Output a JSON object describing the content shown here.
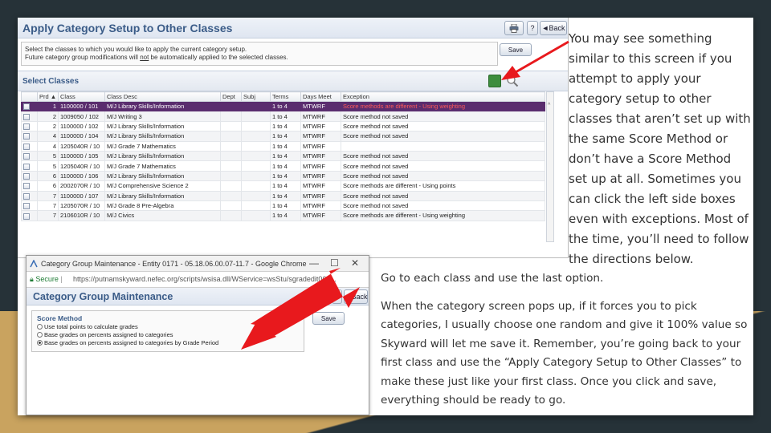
{
  "screenshot1": {
    "title": "Apply Category Setup to Other Classes",
    "print_label": "",
    "help_label": "?",
    "back_label": "◄Back",
    "instructions": {
      "line1": "Select the classes to which you would like to apply the current category setup.",
      "line2_prefix": "Future category group modifications will ",
      "line2_emph": "not",
      "line2_suffix": " be automatically applied to the selected classes."
    },
    "save_label": "Save",
    "section_label": "Select Classes",
    "columns": [
      "",
      "Prd ▲",
      "Class",
      "Class Desc",
      "Dept",
      "Subj",
      "Terms",
      "Days Meet",
      "Exception"
    ],
    "rows": [
      {
        "prd": "1",
        "class": "1100000 / 101",
        "desc": "M/J Library Skills/Information",
        "dept": "",
        "subj": "",
        "terms": "1 to 4",
        "days": "MTWRF",
        "exception": "Score methods are different - Using weighting",
        "selected": true
      },
      {
        "prd": "2",
        "class": "1009050 / 102",
        "desc": "M/J Writing 3",
        "dept": "",
        "subj": "",
        "terms": "1 to 4",
        "days": "MTWRF",
        "exception": "Score method not saved"
      },
      {
        "prd": "2",
        "class": "1100000 / 102",
        "desc": "M/J Library Skills/Information",
        "dept": "",
        "subj": "",
        "terms": "1 to 4",
        "days": "MTWRF",
        "exception": "Score method not saved"
      },
      {
        "prd": "4",
        "class": "1100000 / 104",
        "desc": "M/J Library Skills/Information",
        "dept": "",
        "subj": "",
        "terms": "1 to 4",
        "days": "MTWRF",
        "exception": "Score method not saved"
      },
      {
        "prd": "4",
        "class": "1205040R / 10",
        "desc": "M/J Grade 7 Mathematics",
        "dept": "",
        "subj": "",
        "terms": "1 to 4",
        "days": "MTWRF",
        "exception": ""
      },
      {
        "prd": "5",
        "class": "1100000 / 105",
        "desc": "M/J Library Skills/Information",
        "dept": "",
        "subj": "",
        "terms": "1 to 4",
        "days": "MTWRF",
        "exception": "Score method not saved"
      },
      {
        "prd": "5",
        "class": "1205040R / 10",
        "desc": "M/J Grade 7 Mathematics",
        "dept": "",
        "subj": "",
        "terms": "1 to 4",
        "days": "MTWRF",
        "exception": "Score method not saved"
      },
      {
        "prd": "6",
        "class": "1100000 / 106",
        "desc": "M/J Library Skills/Information",
        "dept": "",
        "subj": "",
        "terms": "1 to 4",
        "days": "MTWRF",
        "exception": "Score method not saved"
      },
      {
        "prd": "6",
        "class": "2002070R / 10",
        "desc": "M/J Comprehensive Science 2",
        "dept": "",
        "subj": "",
        "terms": "1 to 4",
        "days": "MTWRF",
        "exception": "Score methods are different - Using points"
      },
      {
        "prd": "7",
        "class": "1100000 / 107",
        "desc": "M/J Library Skills/Information",
        "dept": "",
        "subj": "",
        "terms": "1 to 4",
        "days": "MTWRF",
        "exception": "Score method not saved"
      },
      {
        "prd": "7",
        "class": "1205070R / 10",
        "desc": "M/J Grade 8 Pre-Algebra",
        "dept": "",
        "subj": "",
        "terms": "1 to 4",
        "days": "MTWRF",
        "exception": "Score method not saved"
      },
      {
        "prd": "7",
        "class": "2106010R / 10",
        "desc": "M/J Civics",
        "dept": "",
        "subj": "",
        "terms": "1 to 4",
        "days": "MTWRF",
        "exception": "Score methods are different - Using weighting"
      }
    ]
  },
  "screenshot2": {
    "window_title": "Category Group Maintenance - Entity 0171 - 05.18.06.00.07-11.7 - Google Chrome",
    "minimize": "—",
    "maximize": "☐",
    "close": "✕",
    "secure_label": "Secure",
    "url": "https://putnamskyward.nefec.org/scripts/wsisa.dll/WService=wsStu/sgradedit060...",
    "title": "Category Group Maintenance",
    "help_label": "?",
    "back_label": "◄Back",
    "save_label": "Save",
    "score_method_label": "Score Method",
    "options": [
      {
        "label": "Use total points to calculate grades",
        "checked": false
      },
      {
        "label": "Base grades on percents assigned to categories",
        "checked": false
      },
      {
        "label": "Base grades on percents assigned to categories by Grade Period",
        "checked": true
      }
    ]
  },
  "right_text": "You may see something similar to this screen if you attempt to apply your category setup to other classes that aren’t set up with the same Score Method or don’t have a Score Method set up at all. Sometimes you can click the left side boxes even with exceptions.  Most of the time, you’ll need to follow the directions below.",
  "bottom_text": {
    "p1": "Go to each class and use the last option.",
    "p2": "When the category screen pops up, if it forces you to pick categories, I usually choose one random and give it 100% value so Skyward will let me save it.  Remember, you’re going back to your first class and use the “Apply Category Setup to Other Classes” to make these just like your first class. Once you click and save, everything should be ready to go."
  },
  "colors": {
    "accent_title": "#3b5c88",
    "selected_row": "#5a2d6e",
    "exception_text": "#e02020",
    "arrow": "#e8191d",
    "backdrop_dark": "#263238",
    "backdrop_gold": "#c9a35f"
  }
}
